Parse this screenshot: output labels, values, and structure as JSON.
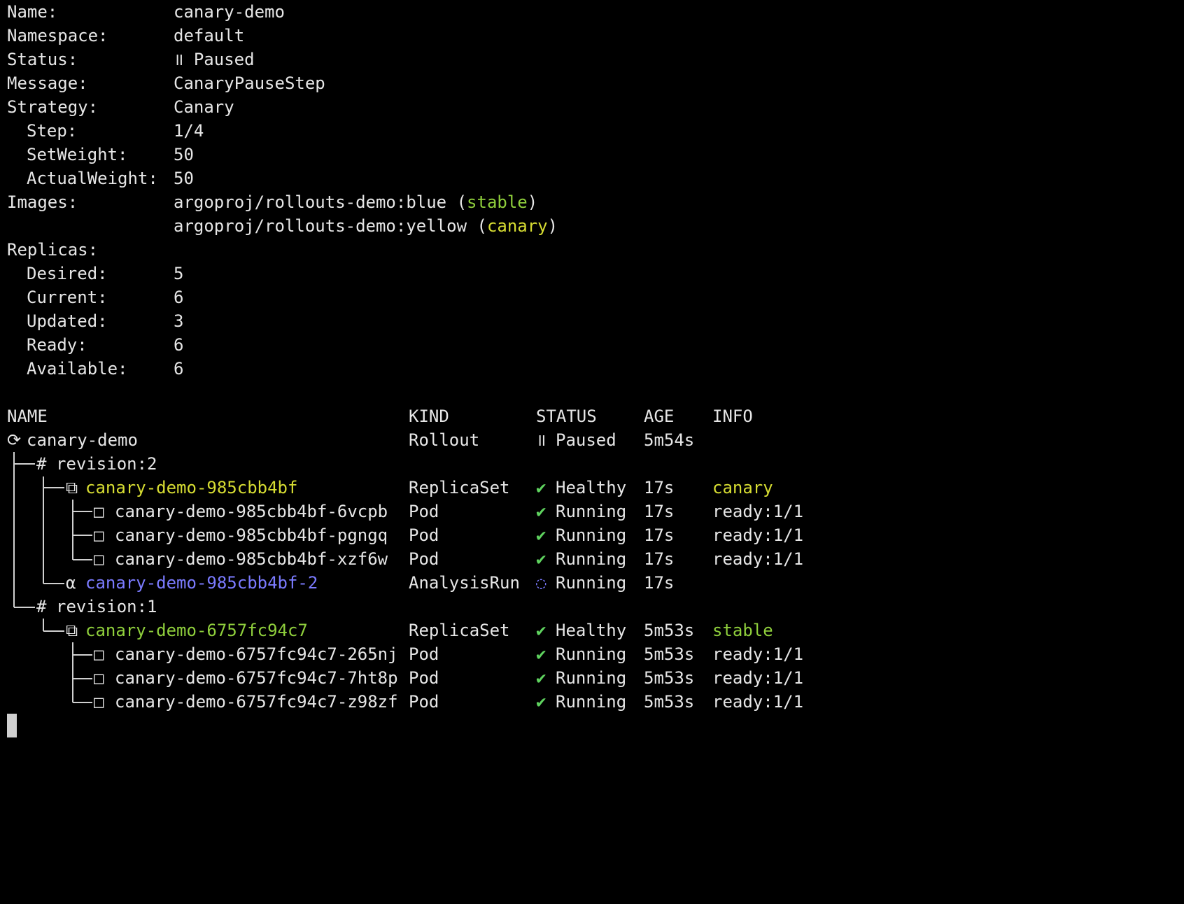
{
  "summary": {
    "name_label": "Name:",
    "name_value": "canary-demo",
    "namespace_label": "Namespace:",
    "namespace_value": "default",
    "status_label": "Status:",
    "status_icon": "॥",
    "status_value": "Paused",
    "message_label": "Message:",
    "message_value": "CanaryPauseStep",
    "strategy_label": "Strategy:",
    "strategy_value": "Canary",
    "step_label": "Step:",
    "step_value": "1/4",
    "setweight_label": "SetWeight:",
    "setweight_value": "50",
    "actualweight_label": "ActualWeight:",
    "actualweight_value": "50",
    "images_label": "Images:",
    "images": [
      {
        "image": "argoproj/rollouts-demo:blue",
        "open": " (",
        "tag": "stable",
        "close": ")"
      },
      {
        "image": "argoproj/rollouts-demo:yellow",
        "open": " (",
        "tag": "canary",
        "close": ")"
      }
    ],
    "replicas_label": "Replicas:",
    "desired_label": "Desired:",
    "desired_value": "5",
    "current_label": "Current:",
    "current_value": "6",
    "updated_label": "Updated:",
    "updated_value": "3",
    "ready_label": "Ready:",
    "ready_value": "6",
    "available_label": "Available:",
    "available_value": "6"
  },
  "table": {
    "headers": {
      "name": "NAME",
      "kind": "KIND",
      "status": "STATUS",
      "age": "AGE",
      "info": "INFO"
    },
    "rows": [
      {
        "prefix": "⟳",
        "name": "canary-demo",
        "kind": "Rollout",
        "status_icon": "॥",
        "status": "Paused",
        "age": "5m54s",
        "info": ""
      },
      {
        "prefix": "#",
        "name": "revision:2",
        "kind": "",
        "status_icon": "",
        "status": "",
        "age": "",
        "info": ""
      },
      {
        "prefix": "⧉",
        "name": "canary-demo-985cbb4bf",
        "kind": "ReplicaSet",
        "status_icon": "✔",
        "status": "Healthy",
        "age": "17s",
        "info": "canary"
      },
      {
        "prefix": "□",
        "name": "canary-demo-985cbb4bf-6vcpb",
        "kind": "Pod",
        "status_icon": "✔",
        "status": "Running",
        "age": "17s",
        "info": "ready:1/1"
      },
      {
        "prefix": "□",
        "name": "canary-demo-985cbb4bf-pgngq",
        "kind": "Pod",
        "status_icon": "✔",
        "status": "Running",
        "age": "17s",
        "info": "ready:1/1"
      },
      {
        "prefix": "□",
        "name": "canary-demo-985cbb4bf-xzf6w",
        "kind": "Pod",
        "status_icon": "✔",
        "status": "Running",
        "age": "17s",
        "info": "ready:1/1"
      },
      {
        "prefix": "α",
        "name": "canary-demo-985cbb4bf-2",
        "kind": "AnalysisRun",
        "status_icon": "◌",
        "status": "Running",
        "age": "17s",
        "info": ""
      },
      {
        "prefix": "#",
        "name": "revision:1",
        "kind": "",
        "status_icon": "",
        "status": "",
        "age": "",
        "info": ""
      },
      {
        "prefix": "⧉",
        "name": "canary-demo-6757fc94c7",
        "kind": "ReplicaSet",
        "status_icon": "✔",
        "status": "Healthy",
        "age": "5m53s",
        "info": "stable"
      },
      {
        "prefix": "□",
        "name": "canary-demo-6757fc94c7-265nj",
        "kind": "Pod",
        "status_icon": "✔",
        "status": "Running",
        "age": "5m53s",
        "info": "ready:1/1"
      },
      {
        "prefix": "□",
        "name": "canary-demo-6757fc94c7-7ht8p",
        "kind": "Pod",
        "status_icon": "✔",
        "status": "Running",
        "age": "5m53s",
        "info": "ready:1/1"
      },
      {
        "prefix": "□",
        "name": "canary-demo-6757fc94c7-z98zf",
        "kind": "Pod",
        "status_icon": "✔",
        "status": "Running",
        "age": "5m53s",
        "info": "ready:1/1"
      }
    ]
  },
  "colors": {
    "background": "#000000",
    "text": "#e6e6e6",
    "stable": "#8fcf3c",
    "canary": "#d6dc32",
    "analysis": "#7b7bff",
    "check": "#5fd35f"
  }
}
